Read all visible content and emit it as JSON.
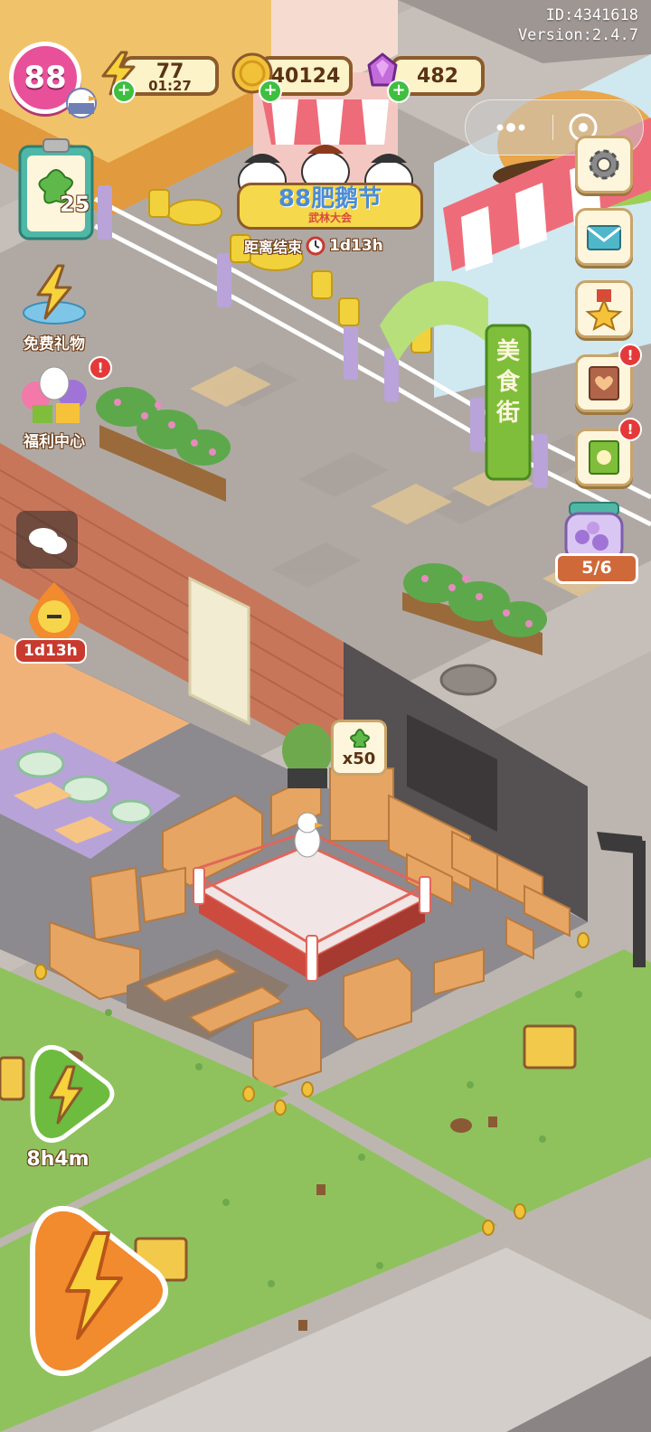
{
  "meta": {
    "id_text": "ID:4341618",
    "version_text": "Version:2.4.7"
  },
  "hud": {
    "level": "88",
    "energy": {
      "value": "77",
      "timer": "01:27",
      "icon": "lightning-icon"
    },
    "coins": {
      "value": "40124",
      "icon": "coin-icon"
    },
    "gems": {
      "value": "482",
      "icon": "gem-icon"
    },
    "clipboard_count": "25"
  },
  "event": {
    "title": "88肥鹅节",
    "subtitle": "武林大会",
    "countdown_label": "距离结束",
    "countdown_value": "1d13h"
  },
  "left_menu": {
    "free_gift": "免费礼物",
    "welfare_center": "福利中心",
    "duck_timer": "1d13h"
  },
  "right_menu": {
    "jar_progress": "5/6"
  },
  "scene": {
    "food_street_sign": "美食街",
    "reward_badge": "x50"
  },
  "bottom": {
    "boost_timer": "8h4m"
  },
  "colors": {
    "grass": "#8fc25d",
    "road": "#c2bbb5",
    "brick": "#c8765a",
    "floor": "#f1b27a",
    "box": "#e6a562"
  }
}
